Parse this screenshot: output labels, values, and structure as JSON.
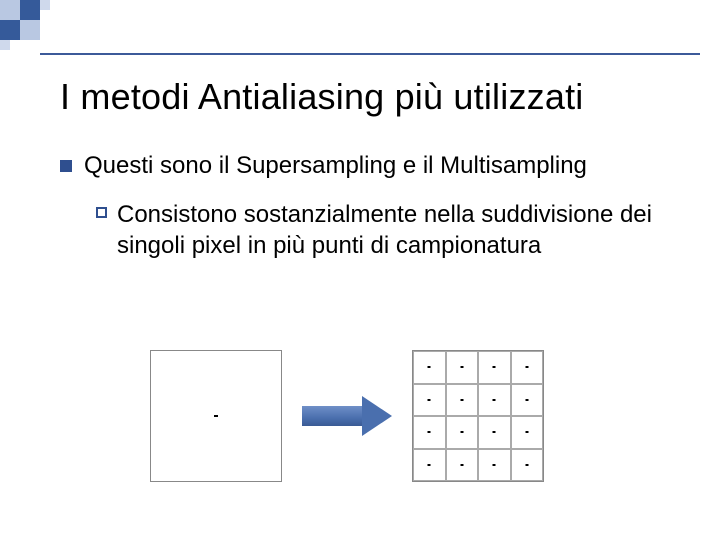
{
  "title": "I metodi Antialiasing più utilizzati",
  "bullets": {
    "lvl1": "Questi sono il Supersampling e il Multisampling",
    "lvl2": "Consistono sostanzialmente nella suddivisione dei singoli pixel in più punti di campionatura"
  },
  "diagram": {
    "left_label": "single-pixel",
    "right_label": "subdivided-pixel-4x4",
    "arrow": "arrow-right"
  }
}
